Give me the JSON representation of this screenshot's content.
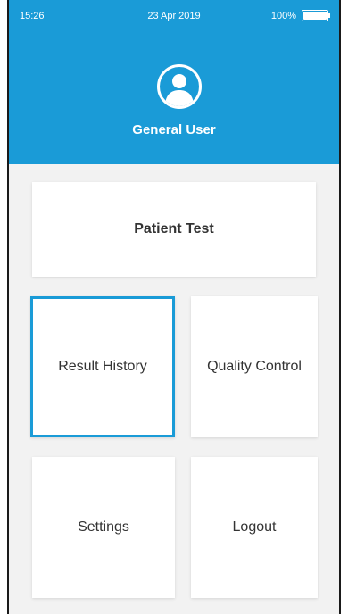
{
  "status_bar": {
    "time": "15:26",
    "date": "23 Apr 2019",
    "battery_percent": "100%",
    "battery_level": 1.0,
    "battery_icon": "battery-icon"
  },
  "user": {
    "avatar_icon": "user-avatar-icon",
    "name": "General User"
  },
  "menu": {
    "patient_test": "Patient Test",
    "result_history": "Result History",
    "quality_control": "Quality Control",
    "settings": "Settings",
    "logout": "Logout"
  },
  "colors": {
    "header_bg": "#1a9bd7",
    "selected_border": "#1a9bd7",
    "background": "#f2f2f2",
    "tile_bg": "#ffffff",
    "text": "#333333"
  }
}
